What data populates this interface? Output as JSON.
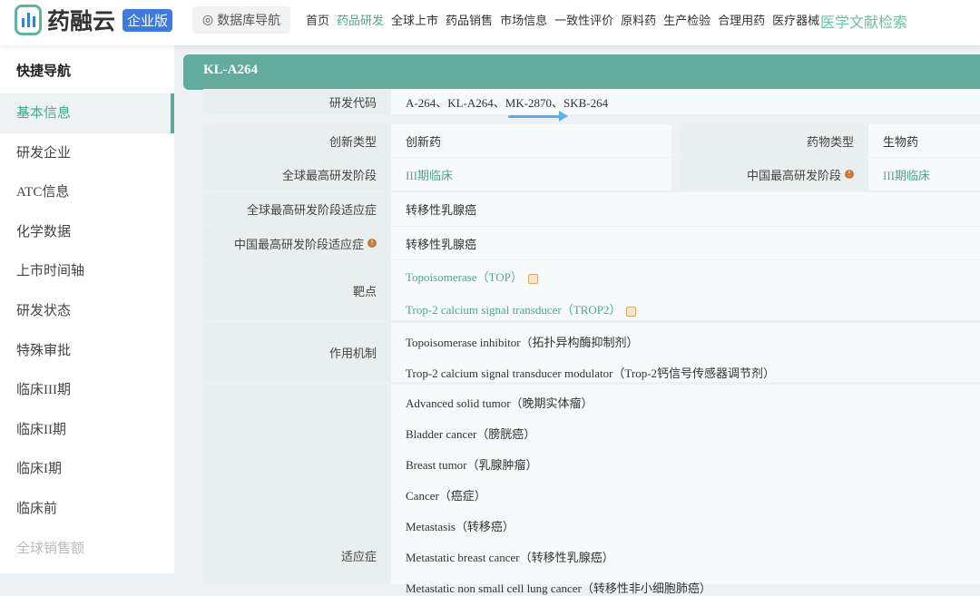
{
  "header": {
    "logo_text": "药融云",
    "edition": "企业版",
    "db_nav": "数据库导航",
    "nav": [
      "首页",
      "药品研发",
      "全球上市",
      "药品销售",
      "市场信息",
      "一致性评价",
      "原料药",
      "生产检验",
      "合理用药",
      "医疗器械"
    ],
    "active_nav": "药品研发",
    "literature": "医学文献检索"
  },
  "sidebar": {
    "title": "快捷导航",
    "items": [
      "基本信息",
      "研发企业",
      "ATC信息",
      "化学数据",
      "上市时间轴",
      "研发状态",
      "特殊审批",
      "临床III期",
      "临床II期",
      "临床I期",
      "临床前",
      "全球销售额"
    ],
    "active": "基本信息"
  },
  "drug": {
    "name": "KL-A264",
    "rows": {
      "code": {
        "label": "研发代码",
        "value": "A-264、KL-A264、MK-2870、SKB-264"
      },
      "innovation": {
        "label": "创新类型",
        "value": "创新药"
      },
      "drug_type": {
        "label": "药物类型",
        "value": "生物药"
      },
      "global_phase": {
        "label": "全球最高研发阶段",
        "value": "III期临床"
      },
      "china_phase": {
        "label": "中国最高研发阶段",
        "value": "III期临床"
      },
      "global_ind": {
        "label": "全球最高研发阶段适应症",
        "value": "转移性乳腺癌"
      },
      "china_ind": {
        "label": "中国最高研发阶段适应症",
        "value": "转移性乳腺癌"
      },
      "target": {
        "label": "靶点",
        "values": [
          "Topoisomerase（TOP）",
          "Trop-2 calcium signal transducer（TROP2）"
        ]
      },
      "mechanism": {
        "label": "作用机制",
        "values": [
          "Topoisomerase inhibitor（拓扑异构酶抑制剂）",
          "Trop-2 calcium signal transducer modulator（Trop-2钙信号传感器调节剂）"
        ]
      },
      "indication": {
        "label": "适应症",
        "values": [
          "Advanced solid tumor（晚期实体瘤）",
          "Bladder cancer（膀胱癌）",
          "Breast tumor（乳腺肿瘤）",
          "Cancer（癌症）",
          "Metastasis（转移癌）",
          "Metastatic breast cancer（转移性乳腺癌）",
          "Metastatic non small cell lung cancer（转移性非小细胞肺癌）"
        ]
      }
    }
  },
  "colors": {
    "accent": "#62ab9d",
    "link": "#4aa88f",
    "brand_blue": "#3d7be0"
  }
}
